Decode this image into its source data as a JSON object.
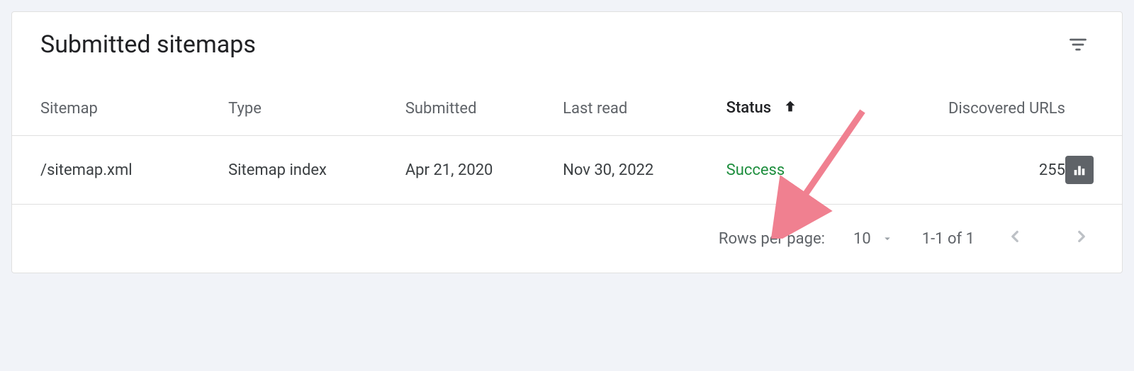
{
  "header": {
    "title": "Submitted sitemaps"
  },
  "table": {
    "columns": {
      "sitemap": "Sitemap",
      "type": "Type",
      "submitted": "Submitted",
      "last_read": "Last read",
      "status": "Status",
      "discovered_urls": "Discovered URLs"
    },
    "sorted_column": "status",
    "sort_direction": "asc",
    "rows": [
      {
        "sitemap": "/sitemap.xml",
        "type": "Sitemap index",
        "submitted": "Apr 21, 2020",
        "last_read": "Nov 30, 2022",
        "status": "Success",
        "status_kind": "success",
        "discovered_urls": "255"
      }
    ]
  },
  "pagination": {
    "rows_per_page_label": "Rows per page:",
    "rows_per_page_value": "10",
    "range_text": "1-1 of 1"
  },
  "annotation": {
    "color": "#f08090"
  }
}
